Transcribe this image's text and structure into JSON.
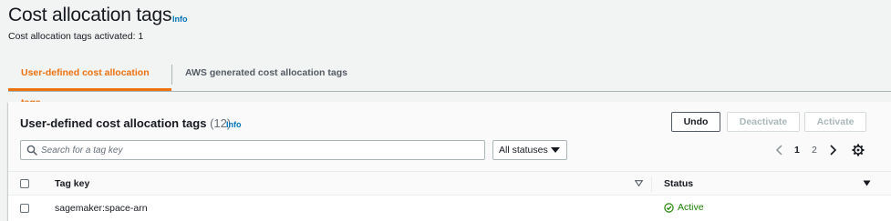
{
  "header": {
    "title": "Cost allocation tags",
    "info_label": "Info",
    "subtitle": "Cost allocation tags activated: 1"
  },
  "tabs": [
    {
      "label": "User-defined cost allocation tags",
      "active": true
    },
    {
      "label": "AWS generated cost allocation tags",
      "active": false
    }
  ],
  "panel": {
    "title": "User-defined cost allocation tags",
    "count": "(12)",
    "info_label": "Info",
    "buttons": {
      "undo": "Undo",
      "deactivate": "Deactivate",
      "activate": "Activate"
    },
    "search": {
      "placeholder": "Search for a tag key",
      "value": ""
    },
    "status_filter": {
      "selected": "All statuses"
    },
    "pagination": {
      "pages": [
        "1",
        "2"
      ],
      "current": "1"
    },
    "table": {
      "columns": [
        "Tag key",
        "Status"
      ],
      "rows": [
        {
          "tag_key": "sagemaker:space-arn",
          "status": "Active"
        }
      ]
    }
  },
  "colors": {
    "accent": "#ec7211",
    "link": "#0073bb",
    "success": "#1d8102",
    "background": "#f2f3f3"
  },
  "icons": [
    "search-icon",
    "chevron-down-icon",
    "chevron-left-icon",
    "chevron-right-icon",
    "gear-icon",
    "sort-icon",
    "caret-down-icon",
    "check-circle-icon"
  ]
}
